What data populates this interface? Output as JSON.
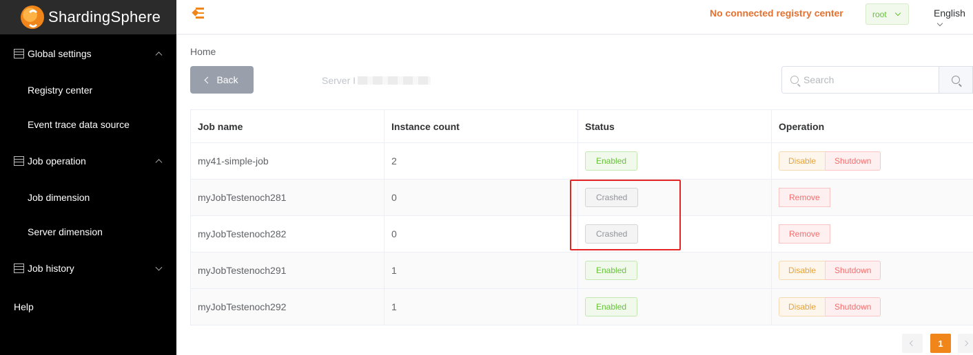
{
  "app": {
    "logo_text": "ShardingSphere",
    "accent_color": "#f08519"
  },
  "sidebar": {
    "groups": [
      {
        "label": "Global settings",
        "expanded": true,
        "items": [
          "Registry center",
          "Event trace data source"
        ]
      },
      {
        "label": "Job operation",
        "expanded": true,
        "items": [
          "Job dimension",
          "Server dimension"
        ]
      },
      {
        "label": "Job history",
        "expanded": false,
        "items": []
      }
    ],
    "help_label": "Help"
  },
  "header": {
    "registry_status": "No connected registry center",
    "user": "root",
    "language": "English"
  },
  "main": {
    "breadcrumb": "Home",
    "back_label": "Back",
    "server_ip_label": "Server I",
    "search_placeholder": "Search"
  },
  "table": {
    "columns": [
      "Job name",
      "Instance count",
      "Status",
      "Operation"
    ],
    "rows": [
      {
        "job_name": "my41-simple-job",
        "instance_count": "2",
        "status": "Enabled",
        "ops": [
          "Disable",
          "Shutdown"
        ]
      },
      {
        "job_name": "myJobTestenoch281",
        "instance_count": "0",
        "status": "Crashed",
        "ops": [
          "Remove"
        ]
      },
      {
        "job_name": "myJobTestenoch282",
        "instance_count": "0",
        "status": "Crashed",
        "ops": [
          "Remove"
        ]
      },
      {
        "job_name": "myJobTestenoch291",
        "instance_count": "1",
        "status": "Enabled",
        "ops": [
          "Disable",
          "Shutdown"
        ]
      },
      {
        "job_name": "myJobTestenoch292",
        "instance_count": "1",
        "status": "Enabled",
        "ops": [
          "Disable",
          "Shutdown"
        ]
      }
    ]
  },
  "pagination": {
    "current_page": "1"
  }
}
